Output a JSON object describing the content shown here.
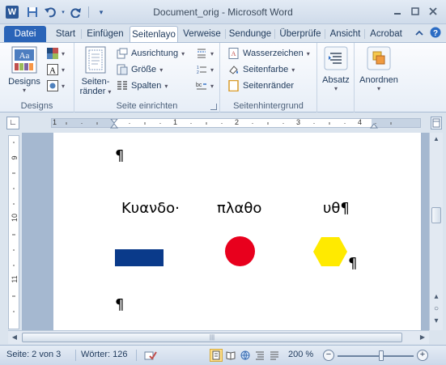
{
  "titlebar": {
    "app_icon": "W",
    "title": "Document_orig - Microsoft Word",
    "qat": [
      "save-icon",
      "undo-icon",
      "redo-icon",
      "customize-icon"
    ],
    "controls": [
      "minimize-icon",
      "restore-icon",
      "close-icon"
    ]
  },
  "tabs": {
    "file": "Datei",
    "items": [
      "Start",
      "Einfügen",
      "Seitenlayo",
      "Verweise",
      "Sendunge",
      "Überprüfe",
      "Ansicht",
      "Acrobat"
    ],
    "active": "Seitenlayo"
  },
  "ribbon": {
    "designs": {
      "label": "Designs",
      "group": "Designs"
    },
    "seite": {
      "margins": "Seiten-",
      "margins2": "ränder",
      "ausrichtung": "Ausrichtung",
      "groesse": "Größe",
      "spalten": "Spalten",
      "group": "Seite einrichten"
    },
    "hintergrund": {
      "wasserzeichen": "Wasserzeichen",
      "seitenfarbe": "Seitenfarbe",
      "seitenraender": "Seitenränder",
      "group": "Seitenhintergrund"
    },
    "absatz": "Absatz",
    "anordnen": "Anordnen"
  },
  "ruler": {
    "h_numbers": [
      "1",
      "1",
      "2",
      "3",
      "4"
    ],
    "v_numbers": [
      "9",
      "10",
      "11"
    ]
  },
  "document": {
    "pilcrow": "¶",
    "word1": "Κυανδο·",
    "word2": "πλαθο",
    "word3": "υθ¶",
    "shapes": [
      {
        "shape": "rectangle",
        "color": "#0a3a8a"
      },
      {
        "shape": "circle",
        "color": "#e8001d"
      },
      {
        "shape": "hexagon",
        "color": "#ffea00"
      }
    ]
  },
  "statusbar": {
    "page": "Seite: 2 von 3",
    "words": "Wörter: 126",
    "zoom": "200 %",
    "zoom_level_percent": 200
  }
}
